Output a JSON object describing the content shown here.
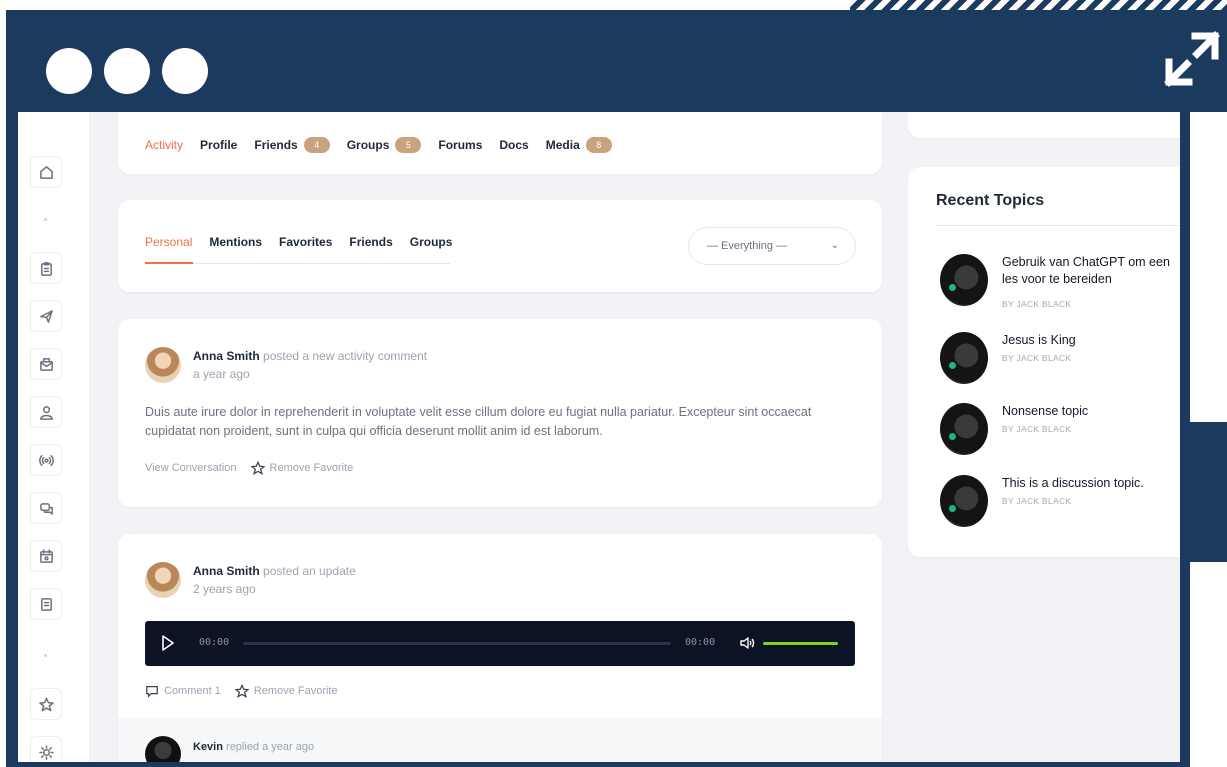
{
  "profile_tabs": [
    {
      "label": "Activity",
      "badge": ""
    },
    {
      "label": "Profile",
      "badge": ""
    },
    {
      "label": "Friends",
      "badge": "4"
    },
    {
      "label": "Groups",
      "badge": "5"
    },
    {
      "label": "Forums",
      "badge": ""
    },
    {
      "label": "Docs",
      "badge": ""
    },
    {
      "label": "Media",
      "badge": "8"
    }
  ],
  "filter_tabs": [
    "Personal",
    "Mentions",
    "Favorites",
    "Friends",
    "Groups"
  ],
  "filter_select": "— Everything —",
  "posts": [
    {
      "author": "Anna Smith",
      "action": "posted a new activity comment",
      "time": "a year ago",
      "body": "Duis aute irure dolor in reprehenderit in voluptate velit esse cillum dolore eu fugiat nulla pariatur. Excepteur sint occaecat cupidatat non proident, sunt in culpa qui officia deserunt mollit anim id est laborum.",
      "view_conversation": "View Conversation",
      "remove_favorite": "Remove Favorite"
    },
    {
      "author": "Anna Smith",
      "action": "posted an update",
      "time": "2 years ago",
      "player": {
        "current": "00:00",
        "duration": "00:00",
        "volume": 1.0
      },
      "comment": "Comment 1",
      "remove_favorite": "Remove Favorite"
    }
  ],
  "reply": {
    "author": "Kevin",
    "text": "replied a year ago"
  },
  "widget": {
    "title": "Recent Topics",
    "topics": [
      {
        "title": "Gebruik van ChatGPT om een les voor te bereiden",
        "by": "BY JACK BLACK"
      },
      {
        "title": "Jesus is King",
        "by": "BY JACK BLACK"
      },
      {
        "title": "Nonsense topic",
        "by": "BY JACK BLACK"
      },
      {
        "title": "This is a discussion topic.",
        "by": "BY JACK BLACK"
      }
    ]
  },
  "colors": {
    "frame": "#1c3a5e",
    "accent": "#f1704b",
    "badge": "#c9a27e",
    "volume": "#7ed321"
  },
  "sidebar_icons": [
    "home-icon",
    "clipboard-icon",
    "send-icon",
    "mail-icon",
    "user-icon",
    "broadcast-icon",
    "chat-icon",
    "calendar-icon",
    "document-icon",
    "star-icon",
    "sun-icon"
  ]
}
